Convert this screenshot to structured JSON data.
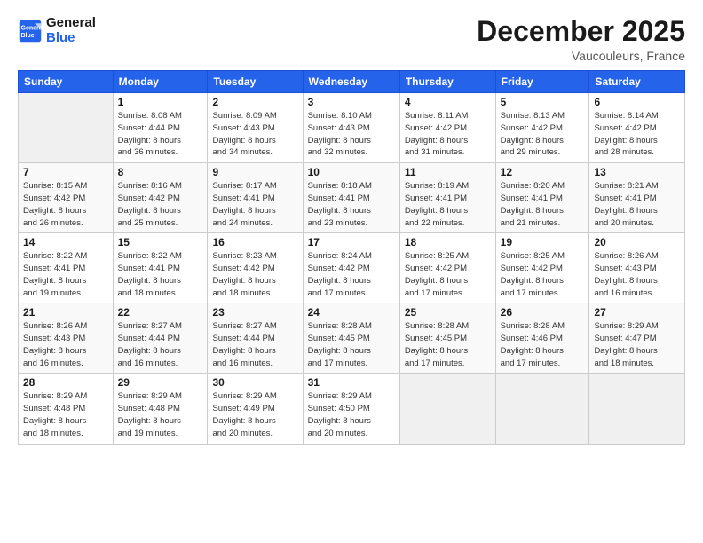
{
  "header": {
    "logo_line1": "General",
    "logo_line2": "Blue",
    "month": "December 2025",
    "location": "Vaucouleurs, France"
  },
  "weekdays": [
    "Sunday",
    "Monday",
    "Tuesday",
    "Wednesday",
    "Thursday",
    "Friday",
    "Saturday"
  ],
  "weeks": [
    [
      {
        "day": "",
        "info": ""
      },
      {
        "day": "1",
        "info": "Sunrise: 8:08 AM\nSunset: 4:44 PM\nDaylight: 8 hours\nand 36 minutes."
      },
      {
        "day": "2",
        "info": "Sunrise: 8:09 AM\nSunset: 4:43 PM\nDaylight: 8 hours\nand 34 minutes."
      },
      {
        "day": "3",
        "info": "Sunrise: 8:10 AM\nSunset: 4:43 PM\nDaylight: 8 hours\nand 32 minutes."
      },
      {
        "day": "4",
        "info": "Sunrise: 8:11 AM\nSunset: 4:42 PM\nDaylight: 8 hours\nand 31 minutes."
      },
      {
        "day": "5",
        "info": "Sunrise: 8:13 AM\nSunset: 4:42 PM\nDaylight: 8 hours\nand 29 minutes."
      },
      {
        "day": "6",
        "info": "Sunrise: 8:14 AM\nSunset: 4:42 PM\nDaylight: 8 hours\nand 28 minutes."
      }
    ],
    [
      {
        "day": "7",
        "info": "Sunrise: 8:15 AM\nSunset: 4:42 PM\nDaylight: 8 hours\nand 26 minutes."
      },
      {
        "day": "8",
        "info": "Sunrise: 8:16 AM\nSunset: 4:42 PM\nDaylight: 8 hours\nand 25 minutes."
      },
      {
        "day": "9",
        "info": "Sunrise: 8:17 AM\nSunset: 4:41 PM\nDaylight: 8 hours\nand 24 minutes."
      },
      {
        "day": "10",
        "info": "Sunrise: 8:18 AM\nSunset: 4:41 PM\nDaylight: 8 hours\nand 23 minutes."
      },
      {
        "day": "11",
        "info": "Sunrise: 8:19 AM\nSunset: 4:41 PM\nDaylight: 8 hours\nand 22 minutes."
      },
      {
        "day": "12",
        "info": "Sunrise: 8:20 AM\nSunset: 4:41 PM\nDaylight: 8 hours\nand 21 minutes."
      },
      {
        "day": "13",
        "info": "Sunrise: 8:21 AM\nSunset: 4:41 PM\nDaylight: 8 hours\nand 20 minutes."
      }
    ],
    [
      {
        "day": "14",
        "info": "Sunrise: 8:22 AM\nSunset: 4:41 PM\nDaylight: 8 hours\nand 19 minutes."
      },
      {
        "day": "15",
        "info": "Sunrise: 8:22 AM\nSunset: 4:41 PM\nDaylight: 8 hours\nand 18 minutes."
      },
      {
        "day": "16",
        "info": "Sunrise: 8:23 AM\nSunset: 4:42 PM\nDaylight: 8 hours\nand 18 minutes."
      },
      {
        "day": "17",
        "info": "Sunrise: 8:24 AM\nSunset: 4:42 PM\nDaylight: 8 hours\nand 17 minutes."
      },
      {
        "day": "18",
        "info": "Sunrise: 8:25 AM\nSunset: 4:42 PM\nDaylight: 8 hours\nand 17 minutes."
      },
      {
        "day": "19",
        "info": "Sunrise: 8:25 AM\nSunset: 4:42 PM\nDaylight: 8 hours\nand 17 minutes."
      },
      {
        "day": "20",
        "info": "Sunrise: 8:26 AM\nSunset: 4:43 PM\nDaylight: 8 hours\nand 16 minutes."
      }
    ],
    [
      {
        "day": "21",
        "info": "Sunrise: 8:26 AM\nSunset: 4:43 PM\nDaylight: 8 hours\nand 16 minutes."
      },
      {
        "day": "22",
        "info": "Sunrise: 8:27 AM\nSunset: 4:44 PM\nDaylight: 8 hours\nand 16 minutes."
      },
      {
        "day": "23",
        "info": "Sunrise: 8:27 AM\nSunset: 4:44 PM\nDaylight: 8 hours\nand 16 minutes."
      },
      {
        "day": "24",
        "info": "Sunrise: 8:28 AM\nSunset: 4:45 PM\nDaylight: 8 hours\nand 17 minutes."
      },
      {
        "day": "25",
        "info": "Sunrise: 8:28 AM\nSunset: 4:45 PM\nDaylight: 8 hours\nand 17 minutes."
      },
      {
        "day": "26",
        "info": "Sunrise: 8:28 AM\nSunset: 4:46 PM\nDaylight: 8 hours\nand 17 minutes."
      },
      {
        "day": "27",
        "info": "Sunrise: 8:29 AM\nSunset: 4:47 PM\nDaylight: 8 hours\nand 18 minutes."
      }
    ],
    [
      {
        "day": "28",
        "info": "Sunrise: 8:29 AM\nSunset: 4:48 PM\nDaylight: 8 hours\nand 18 minutes."
      },
      {
        "day": "29",
        "info": "Sunrise: 8:29 AM\nSunset: 4:48 PM\nDaylight: 8 hours\nand 19 minutes."
      },
      {
        "day": "30",
        "info": "Sunrise: 8:29 AM\nSunset: 4:49 PM\nDaylight: 8 hours\nand 20 minutes."
      },
      {
        "day": "31",
        "info": "Sunrise: 8:29 AM\nSunset: 4:50 PM\nDaylight: 8 hours\nand 20 minutes."
      },
      {
        "day": "",
        "info": ""
      },
      {
        "day": "",
        "info": ""
      },
      {
        "day": "",
        "info": ""
      }
    ]
  ]
}
